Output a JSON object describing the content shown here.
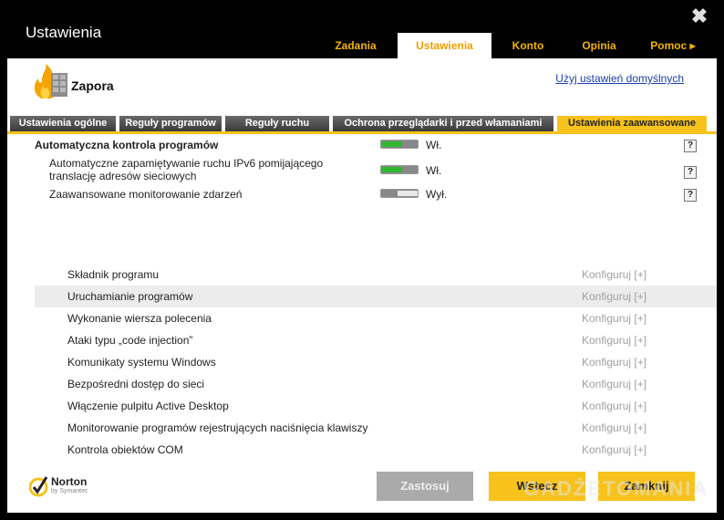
{
  "window": {
    "title": "Ustawienia",
    "close_glyph": "✖"
  },
  "tabs": [
    {
      "label": "Zadania",
      "active": false
    },
    {
      "label": "Ustawienia",
      "active": true
    },
    {
      "label": "Konto",
      "active": false
    },
    {
      "label": "Opinia",
      "active": false
    },
    {
      "label": "Pomoc",
      "active": false,
      "arrow": "▸"
    }
  ],
  "section": {
    "title": "Zapora",
    "icon": "firewall-flame-icon",
    "defaults_link": "Użyj ustawień domyślnych"
  },
  "subtabs": [
    {
      "label": "Ustawienia ogólne",
      "active": false
    },
    {
      "label": "Reguły programów",
      "active": false
    },
    {
      "label": "Reguły ruchu",
      "active": false
    },
    {
      "label": "Ochrona przeglądarki i przed włamaniami",
      "active": false
    },
    {
      "label": "Ustawienia zaawansowane",
      "active": true
    }
  ],
  "settings": {
    "main": {
      "label": "Automatyczna kontrola programów",
      "state": "Wł.",
      "on": true,
      "help": "?"
    },
    "ipv6": {
      "label_line1": "Automatyczne zapamiętywanie ruchu IPv6 pomijającego",
      "label_line2": "translację adresów sieciowych",
      "state": "Wł.",
      "on": true,
      "help": "?"
    },
    "monitor": {
      "label": "Zaawansowane monitorowanie zdarzeń",
      "state": "Wył.",
      "on": false,
      "help": "?"
    }
  },
  "events": [
    {
      "label": "Składnik programu",
      "action": "Konfiguruj [+]"
    },
    {
      "label": "Uruchamianie programów",
      "action": "Konfiguruj [+]"
    },
    {
      "label": "Wykonanie wiersza polecenia",
      "action": "Konfiguruj [+]"
    },
    {
      "label": "Ataki typu „code injection”",
      "action": "Konfiguruj [+]"
    },
    {
      "label": "Komunikaty systemu Windows",
      "action": "Konfiguruj [+]"
    },
    {
      "label": "Bezpośredni dostęp do sieci",
      "action": "Konfiguruj [+]"
    },
    {
      "label": "Włączenie pulpitu Active Desktop",
      "action": "Konfiguruj [+]"
    },
    {
      "label": "Monitorowanie programów rejestrujących naciśnięcia klawiszy",
      "action": "Konfiguruj [+]"
    },
    {
      "label": "Kontrola obiektów COM",
      "action": "Konfiguruj [+]"
    }
  ],
  "footer": {
    "brand": "Norton",
    "brand_sub": "by Symantec",
    "apply": "Zastosuj",
    "back": "Wstecz",
    "close": "Zamknij",
    "watermark": "GADŻETOMANIA"
  },
  "colors": {
    "accent": "#f7c21b",
    "tab_text": "#f4b400",
    "toggle_on": "#2fb82f",
    "link": "#1a3fa8"
  }
}
